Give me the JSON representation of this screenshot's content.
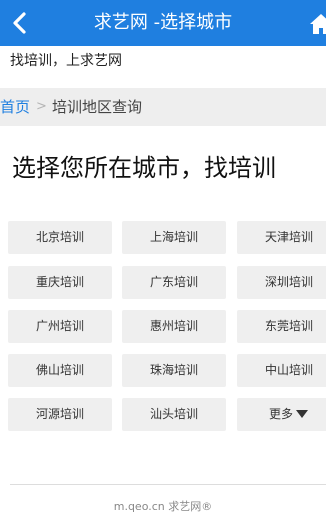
{
  "header": {
    "title": "求艺网 -选择城市",
    "back_icon": "back-chevron-icon",
    "home_icon": "home-icon"
  },
  "slogan": "找培训，上求艺网",
  "breadcrumb": {
    "home": "首页",
    "separator": ">",
    "current": "培训地区查询"
  },
  "heading": "选择您所在城市，找培训",
  "cities": [
    "北京培训",
    "上海培训",
    "天津培训",
    "重庆培训",
    "广东培训",
    "深圳培训",
    "广州培训",
    "惠州培训",
    "东莞培训",
    "佛山培训",
    "珠海培训",
    "中山培训",
    "河源培训",
    "汕头培训"
  ],
  "more_label": "更多",
  "footer": "m.qeo.cn 求艺网®",
  "colors": {
    "accent": "#1f7fe0",
    "button_bg": "#efefef",
    "crumb_bg": "#eeeeee"
  }
}
